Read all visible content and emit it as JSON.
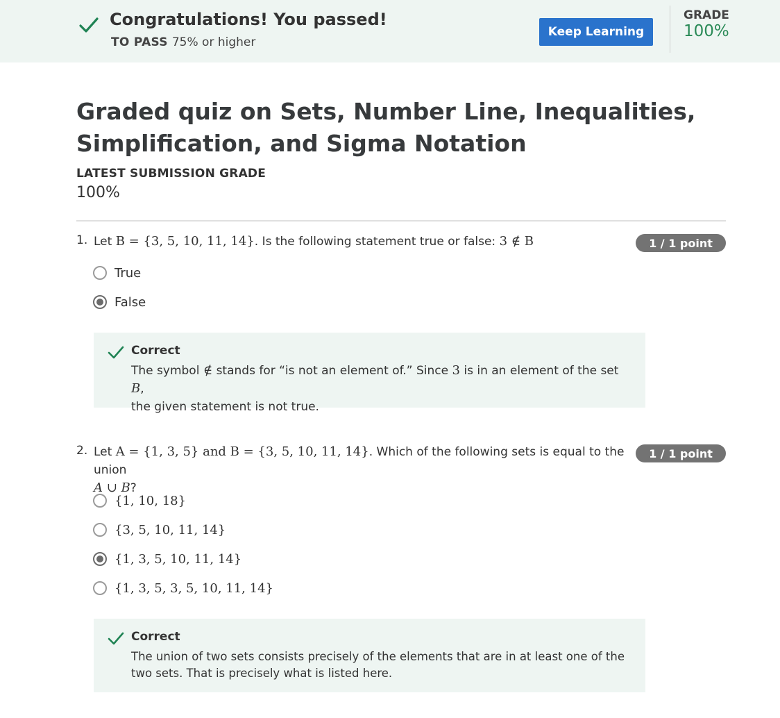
{
  "banner": {
    "title": "Congratulations! You passed!",
    "to_pass_label": "TO PASS",
    "to_pass_value": "75% or higher",
    "keep_learning_label": "Keep Learning",
    "grade_label": "GRADE",
    "grade_value": "100%"
  },
  "quiz": {
    "title": "Graded quiz on Sets, Number Line, Inequalities, Simplification, and Sigma Notation",
    "latest_label": "LATEST SUBMISSION GRADE",
    "latest_value": "100%"
  },
  "questions": [
    {
      "number": "1.",
      "text_prefix": "Let",
      "math_a": "B = {3, 5, 10, 11, 14}",
      "text_mid": ". Is the following statement true or false:",
      "math_b": "3 ∉ B",
      "points": "1 / 1 point",
      "options": [
        {
          "label": "True",
          "selected": false
        },
        {
          "label": "False",
          "selected": true
        }
      ],
      "feedback_title": "Correct",
      "feedback_line1_a": "The symbol",
      "feedback_line1_sym": "∉",
      "feedback_line1_b": "stands for “is not an element of.” Since",
      "feedback_line1_num": "3",
      "feedback_line1_c": "is in an element of the set",
      "feedback_line1_set": "B",
      "feedback_line1_d": ",",
      "feedback_line2": "the given statement is not true."
    },
    {
      "number": "2.",
      "text_prefix": "Let",
      "math_a": "A = {1, 3, 5} and B = {3, 5, 10, 11, 14}",
      "text_mid": ". Which of the following sets is equal to the union",
      "math_b": "A ∪ B",
      "text_end": "?",
      "points": "1 / 1 point",
      "options": [
        {
          "label": "{1, 10, 18}",
          "selected": false
        },
        {
          "label": "{3, 5, 10, 11, 14}",
          "selected": false
        },
        {
          "label": "{1, 3, 5, 10, 11, 14}",
          "selected": true
        },
        {
          "label": "{1, 3, 5, 3, 5, 10, 11, 14}",
          "selected": false
        }
      ],
      "feedback_title": "Correct",
      "feedback_line1": "The union of two sets consists precisely of the elements that are in at least one of the",
      "feedback_line2": "two sets. That is precisely what is listed here."
    }
  ],
  "colors": {
    "banner_bg": "#eef5f2",
    "button_blue": "#2a73cc",
    "grade_green": "#2a8a57",
    "check_green": "#1f8354",
    "pill_gray": "#737373"
  }
}
